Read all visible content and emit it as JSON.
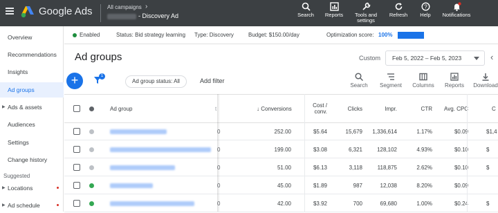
{
  "header": {
    "brand": "Google Ads",
    "breadcrumb_top": "All campaigns",
    "campaign_name": "- Discovery Ad",
    "tools": [
      {
        "label": "Search",
        "icon": "search-icon"
      },
      {
        "label": "Reports",
        "icon": "reports-icon"
      },
      {
        "label": "Tools and settings",
        "icon": "wrench-icon"
      },
      {
        "label": "Refresh",
        "icon": "refresh-icon"
      },
      {
        "label": "Help",
        "icon": "help-icon"
      },
      {
        "label": "Notifications",
        "icon": "bell-icon"
      }
    ]
  },
  "sidebar": {
    "items": [
      {
        "label": "Overview"
      },
      {
        "label": "Recommendations"
      },
      {
        "label": "Insights"
      },
      {
        "label": "Ad groups",
        "active": true
      },
      {
        "label": "Ads & assets",
        "expandable": true
      },
      {
        "label": "Audiences"
      },
      {
        "label": "Settings"
      },
      {
        "label": "Change history"
      }
    ],
    "section_label": "Suggested",
    "suggested_items": [
      {
        "label": "Locations",
        "expandable": true
      },
      {
        "label": "Ad schedule",
        "expandable": true
      }
    ]
  },
  "status_bar": {
    "enabled": "Enabled",
    "status": "Status: Bid strategy learning",
    "type": "Type: Discovery",
    "budget": "Budget: $150.00/day",
    "opt_label": "Optimization score:",
    "opt_value": "100%"
  },
  "page": {
    "title": "Ad groups",
    "date_label": "Custom",
    "date_range": "Feb 5, 2022 – Feb 5, 2023"
  },
  "toolbar": {
    "add": "+",
    "filter_count": "1",
    "status_chip": "Ad group status: All",
    "add_filter": "Add filter",
    "buttons": [
      {
        "label": "Search",
        "icon": "search-icon"
      },
      {
        "label": "Segment",
        "icon": "segment-icon"
      },
      {
        "label": "Columns",
        "icon": "columns-icon"
      },
      {
        "label": "Reports",
        "icon": "reports-icon"
      },
      {
        "label": "Download",
        "icon": "download-icon"
      }
    ]
  },
  "table": {
    "headers": {
      "ad_group": "Ad group",
      "truncated": "t",
      "conversions": "Conversions",
      "cost_conv_1": "Cost /",
      "cost_conv_2": "conv.",
      "clicks": "Clicks",
      "impr": "Impr.",
      "ctr": "CTR",
      "avg_cpc": "Avg. CPC",
      "cost_partial": "C"
    },
    "rows": [
      {
        "status": "grey",
        "trunc": "0",
        "conversions": "252.00",
        "cost_conv": "$5.64",
        "clicks": "15,679",
        "impr": "1,336,614",
        "ctr": "1.17%",
        "avg_cpc": "$0.09",
        "cost": "$1,4"
      },
      {
        "status": "grey",
        "trunc": "0",
        "conversions": "199.00",
        "cost_conv": "$3.08",
        "clicks": "6,321",
        "impr": "128,102",
        "ctr": "4.93%",
        "avg_cpc": "$0.10",
        "cost": "$"
      },
      {
        "status": "grey",
        "trunc": "0",
        "conversions": "51.00",
        "cost_conv": "$6.13",
        "clicks": "3,118",
        "impr": "118,875",
        "ctr": "2.62%",
        "avg_cpc": "$0.10",
        "cost": "$"
      },
      {
        "status": "green",
        "trunc": "0",
        "conversions": "45.00",
        "cost_conv": "$1.89",
        "clicks": "987",
        "impr": "12,038",
        "ctr": "8.20%",
        "avg_cpc": "$0.09",
        "cost": ""
      },
      {
        "status": "green",
        "trunc": "0",
        "conversions": "42.00",
        "cost_conv": "$3.92",
        "clicks": "700",
        "impr": "69,680",
        "ctr": "1.00%",
        "avg_cpc": "$0.24",
        "cost": "$"
      }
    ]
  },
  "colors": {
    "accent": "#1a73e8",
    "topbar": "#3c4043",
    "enabled": "#1e8e3e",
    "notification_dot": "#d93025"
  }
}
